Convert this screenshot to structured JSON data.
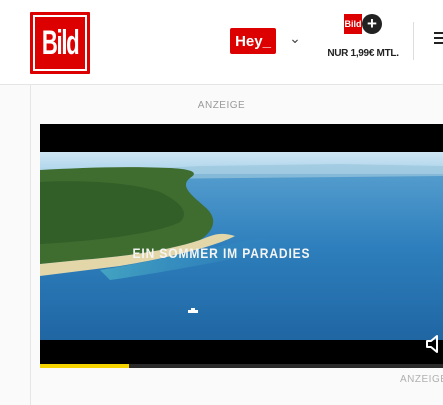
{
  "header": {
    "logo_text": "Bild",
    "hey_label": "Hey_",
    "chevron": "⌄",
    "bildplus": {
      "logo_text": "Bild",
      "plus": "+",
      "price_text": "NUR 1,99€ MTL."
    },
    "menu_icon": "hamburger-icon"
  },
  "ad": {
    "label_top": "ANZEIGE",
    "video": {
      "caption": "EIN SOMMER IM PARADIES",
      "progress": 0.22,
      "speaker_icon": "speaker-icon"
    },
    "label_bottom": "ANZEIGE"
  },
  "colors": {
    "brand_red": "#dd0000",
    "progress_yellow": "#f5d400"
  }
}
